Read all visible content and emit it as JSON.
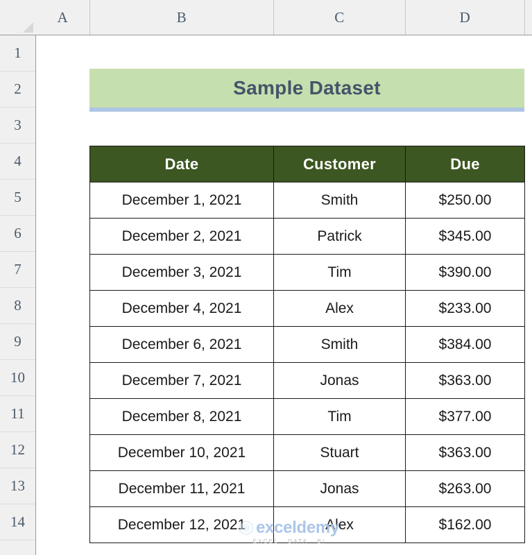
{
  "app": {
    "type": "spreadsheet",
    "corner_icon": "select-all-triangle-icon"
  },
  "grid": {
    "column_headers": [
      "A",
      "B",
      "C",
      "D"
    ],
    "row_headers": [
      "1",
      "2",
      "3",
      "4",
      "5",
      "6",
      "7",
      "8",
      "9",
      "10",
      "11",
      "12",
      "13",
      "14"
    ]
  },
  "title_banner": {
    "text": "Sample Dataset",
    "background_color": "#C6DFAF",
    "text_color": "#44546A",
    "underline_color": "#ADC6E5"
  },
  "table": {
    "header_background": "#3C5721",
    "header_text_color": "#FFFFFF",
    "columns": [
      "Date",
      "Customer",
      "Due"
    ],
    "rows": [
      {
        "date": "December 1, 2021",
        "customer": "Smith",
        "due": "$250.00"
      },
      {
        "date": "December 2, 2021",
        "customer": "Patrick",
        "due": "$345.00"
      },
      {
        "date": "December 3, 2021",
        "customer": "Tim",
        "due": "$390.00"
      },
      {
        "date": "December 4, 2021",
        "customer": "Alex",
        "due": "$233.00"
      },
      {
        "date": "December 6, 2021",
        "customer": "Smith",
        "due": "$384.00"
      },
      {
        "date": "December 7, 2021",
        "customer": "Jonas",
        "due": "$363.00"
      },
      {
        "date": "December 8, 2021",
        "customer": "Tim",
        "due": "$377.00"
      },
      {
        "date": "December 10, 2021",
        "customer": "Stuart",
        "due": "$363.00"
      },
      {
        "date": "December 11, 2021",
        "customer": "Jonas",
        "due": "$263.00"
      },
      {
        "date": "December 12, 2021",
        "customer": "Alex",
        "due": "$162.00"
      }
    ]
  },
  "watermark": {
    "name": "exceldemy",
    "tagline": "EXCEL - DATA - BI",
    "color": "#A8C4E8"
  }
}
